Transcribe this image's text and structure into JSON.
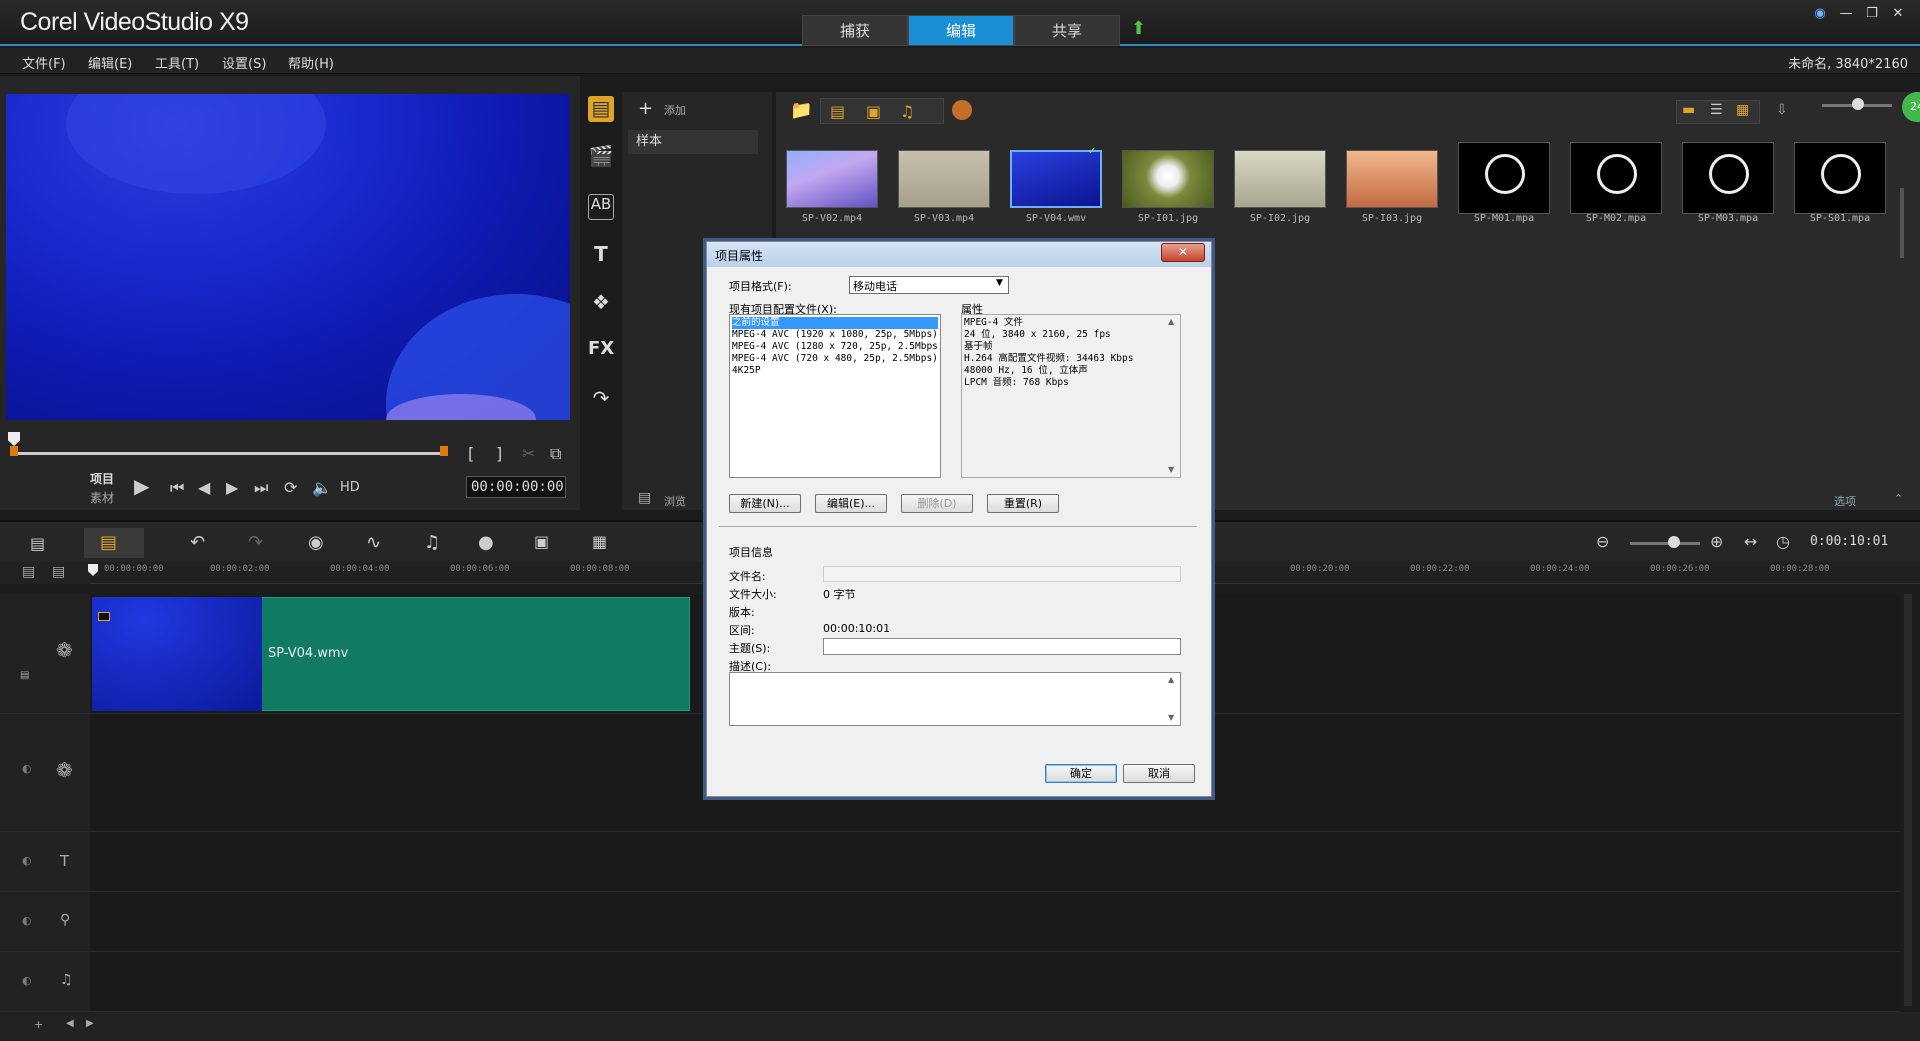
{
  "app": {
    "title": "Corel VideoStudio X9"
  },
  "tabs": [
    {
      "label": "捕获"
    },
    {
      "label": "编辑"
    },
    {
      "label": "共享"
    }
  ],
  "menu": [
    {
      "label": "文件(F)"
    },
    {
      "label": "编辑(E)"
    },
    {
      "label": "工具(T)"
    },
    {
      "label": "设置(S)"
    },
    {
      "label": "帮助(H)"
    }
  ],
  "project_info": "未命名, 3840*2160",
  "player": {
    "mode_project": "项目",
    "mode_clip": "素材",
    "hd": "HD",
    "timecode": "00:00:00:00"
  },
  "library": {
    "add_label": "添加",
    "folder": "样本",
    "browse": "浏览",
    "options": "选项",
    "items": [
      {
        "name": "SP-V02.mp4",
        "kind": "video"
      },
      {
        "name": "SP-V03.mp4",
        "kind": "video"
      },
      {
        "name": "SP-V04.wmv",
        "kind": "video"
      },
      {
        "name": "SP-I01.jpg",
        "kind": "image"
      },
      {
        "name": "SP-I02.jpg",
        "kind": "image"
      },
      {
        "name": "SP-I03.jpg",
        "kind": "image"
      },
      {
        "name": "SP-M01.mpa",
        "kind": "audio"
      },
      {
        "name": "SP-M02.mpa",
        "kind": "audio"
      },
      {
        "name": "SP-M03.mpa",
        "kind": "audio"
      },
      {
        "name": "SP-S01.mpa",
        "kind": "audio"
      }
    ]
  },
  "timeline": {
    "duration": "0:00:10:01",
    "ruler": [
      "00:00:00:00",
      "00:00:02:00",
      "00:00:04:00",
      "00:00:06:00",
      "00:00:08:00",
      "00:00:20:00",
      "00:00:22:00",
      "00:00:24:00",
      "00:00:26:00",
      "00:00:28:00"
    ],
    "clip_name": "SP-V04.wmv"
  },
  "dialog": {
    "title": "项目属性",
    "format_label": "项目格式(F):",
    "format_value": "移动电话",
    "profiles_label": "现有项目配置文件(X):",
    "profiles": [
      "之前的设置",
      "MPEG-4 AVC (1920 x 1080, 25p, 5Mbps)",
      "MPEG-4 AVC (1280 x 720, 25p, 2.5Mbps)",
      "MPEG-4 AVC (720 x 480, 25p, 2.5Mbps)",
      "4K25P"
    ],
    "props_label": "属性",
    "props": [
      "MPEG-4 文件",
      "24 位, 3840 x 2160, 25 fps",
      "基于帧",
      "H.264 高配置文件视频: 34463 Kbps",
      "48000 Hz, 16 位, 立体声",
      "LPCM 音频: 768 Kbps"
    ],
    "btn_new": "新建(N)...",
    "btn_edit": "编辑(E)...",
    "btn_delete": "删除(D)",
    "btn_reset": "重置(R)",
    "info_label": "项目信息",
    "filename_label": "文件名:",
    "filesize_label": "文件大小:",
    "filesize_value": "0 字节",
    "version_label": "版本:",
    "duration_label": "区间:",
    "duration_value": "00:00:10:01",
    "subject_label": "主题(S):",
    "desc_label": "描述(C):",
    "ok": "确定",
    "cancel": "取消"
  }
}
